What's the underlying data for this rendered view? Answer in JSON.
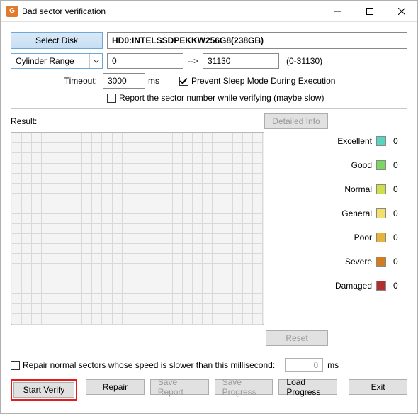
{
  "titlebar": {
    "title": "Bad sector verification",
    "app_icon_letter": "G"
  },
  "disk": {
    "select_label": "Select Disk",
    "selected": "HD0:INTELSSDPEKKW256G8(238GB)"
  },
  "range": {
    "mode": "Cylinder Range",
    "from": "0",
    "to": "31130",
    "hint": "(0-31130)",
    "arrow": "-->"
  },
  "timeout": {
    "label": "Timeout:",
    "value": "3000",
    "unit": "ms"
  },
  "options": {
    "prevent_sleep": "Prevent Sleep Mode During Execution",
    "report_sector": "Report the sector number while verifying (maybe slow)"
  },
  "result": {
    "label": "Result:",
    "detailed": "Detailed Info",
    "reset": "Reset"
  },
  "legend": [
    {
      "label": "Excellent",
      "color": "#56d6c0",
      "count": "0"
    },
    {
      "label": "Good",
      "color": "#7ad862",
      "count": "0"
    },
    {
      "label": "Normal",
      "color": "#cde04a",
      "count": "0"
    },
    {
      "label": "General",
      "color": "#f2e06a",
      "count": "0"
    },
    {
      "label": "Poor",
      "color": "#e9b33a",
      "count": "0"
    },
    {
      "label": "Severe",
      "color": "#d67a1f",
      "count": "0"
    },
    {
      "label": "Damaged",
      "color": "#b12f2f",
      "count": "0"
    }
  ],
  "repair": {
    "option": "Repair normal sectors whose speed is slower than this millisecond:",
    "value": "0",
    "unit": "ms"
  },
  "buttons": {
    "start_verify": "Start Verify",
    "repair": "Repair",
    "save_report": "Save Report",
    "save_progress": "Save Progress",
    "load_progress": "Load Progress",
    "exit": "Exit"
  }
}
